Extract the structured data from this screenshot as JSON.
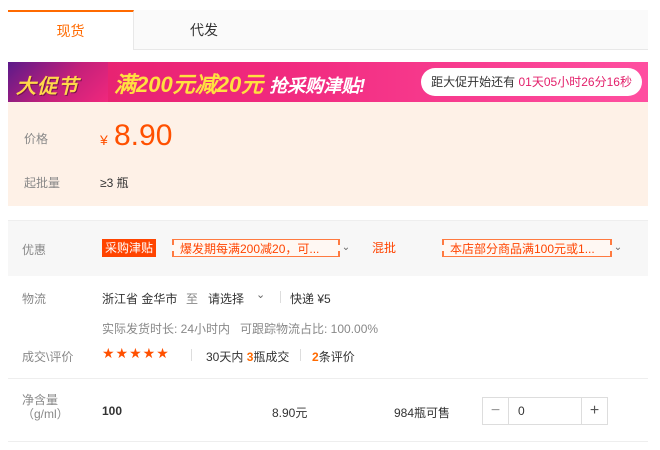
{
  "tabs": [
    {
      "label": "现货",
      "active": true
    },
    {
      "label": "代发",
      "active": false
    }
  ],
  "banner": {
    "logo_text": "大促节",
    "slogan_main": "满200元减20元",
    "slogan_sub": "抢采购津贴!",
    "countdown_prefix": "距大促开始还有",
    "countdown_days": "01",
    "countdown_days_unit": "天",
    "countdown_hours": "05",
    "countdown_hours_unit": "小时",
    "countdown_minutes": "26",
    "countdown_minutes_unit": "分",
    "countdown_seconds": "16",
    "countdown_seconds_unit": "秒"
  },
  "price": {
    "label": "价格",
    "currency": "¥",
    "value": "8.90",
    "moq_label": "起批量",
    "moq_value": "≥3 瓶"
  },
  "promotions": {
    "label": "优惠",
    "tag": "采购津贴",
    "coupon1": "爆发期每满200减20，可...",
    "mix_label": "混批",
    "coupon2": "本店部分商品满100元或1..."
  },
  "logistics": {
    "label": "物流",
    "origin": "浙江省 金华市",
    "to": "至",
    "destination": "请选择",
    "shipping": "快递 ¥5",
    "ship_time": "实际发货时长: 24小时内",
    "trackable": "可跟踪物流占比: 100.00%"
  },
  "reviews": {
    "label": "成交\\评价",
    "stars": "★★★★★",
    "rating": 5,
    "deals_prefix": "30天内",
    "deals_count": "3",
    "deals_suffix": "瓶成交",
    "review_count": "2",
    "review_suffix": "条评价"
  },
  "spec": {
    "label_line1": "净含量",
    "label_line2": "（g/ml）",
    "name": "100",
    "price": "8.90元",
    "stock": "984瓶可售",
    "quantity": "0"
  },
  "colors": {
    "accent": "#ff6a00",
    "price": "#ff5000",
    "banner": "#e3206b",
    "pricebox_bg": "#fef1e7"
  }
}
